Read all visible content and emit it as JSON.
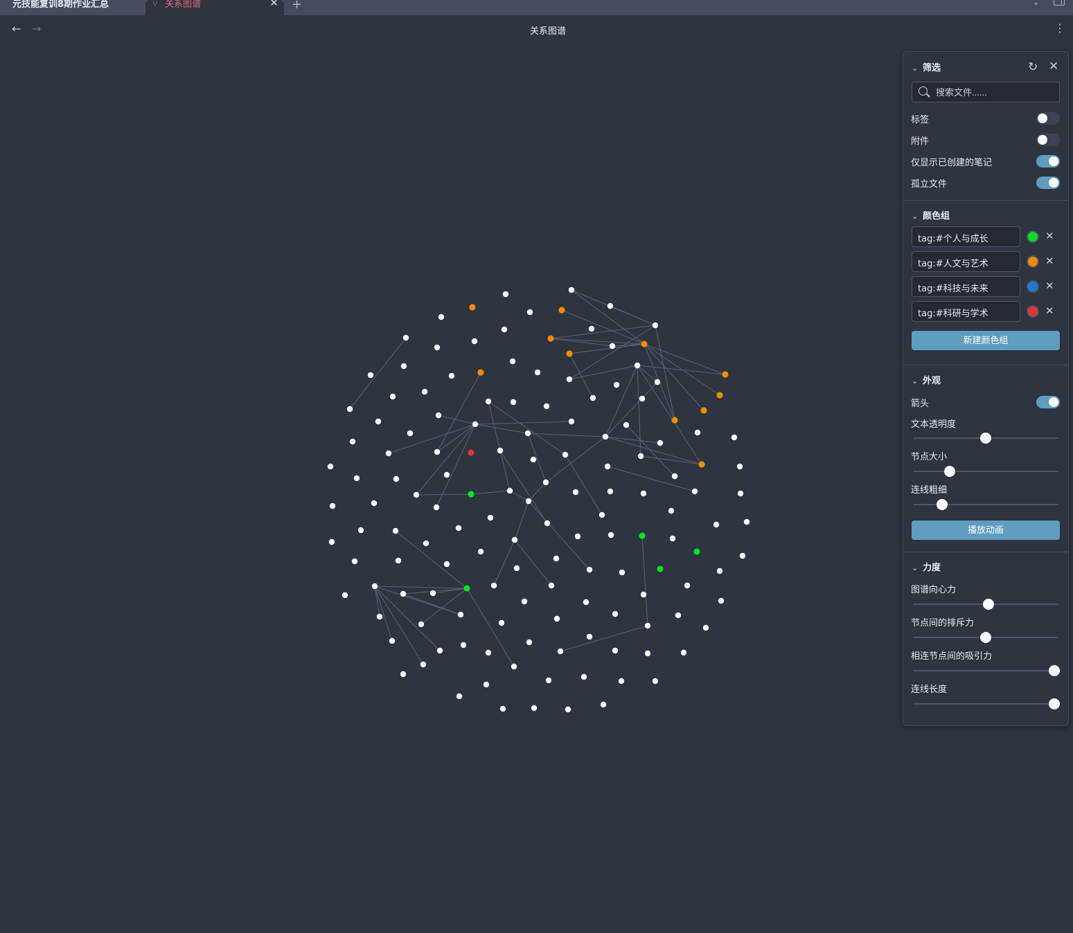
{
  "tabs": [
    {
      "label": "元技能复训8期作业汇总"
    },
    {
      "label": "关系图谱"
    }
  ],
  "header": {
    "title": "关系图谱"
  },
  "icons": {
    "back": "←",
    "forward": "→",
    "more": "⋮",
    "close": "✕",
    "add": "+",
    "chevron_down": "⌄",
    "graph": "⑂",
    "reset": "↻"
  },
  "colors": {
    "background": "#2e3440",
    "accent": "#5e9dbf",
    "node_default": "#ffffff",
    "edge": "#5a6274"
  },
  "panel": {
    "filter": {
      "title": "筛选",
      "search_placeholder": "搜索文件......",
      "toggles": [
        {
          "label": "标签",
          "on": false
        },
        {
          "label": "附件",
          "on": false
        },
        {
          "label": "仅显示已创建的笔记",
          "on": true
        },
        {
          "label": "孤立文件",
          "on": true
        }
      ]
    },
    "groups": {
      "title": "颜色组",
      "items": [
        {
          "query": "tag:#个人与成长",
          "color": "#00e31f"
        },
        {
          "query": "tag:#人文与艺术",
          "color": "#f28c00"
        },
        {
          "query": "tag:#科技与未来",
          "color": "#1f78d1"
        },
        {
          "query": "tag:#科研与学术",
          "color": "#e03535"
        }
      ],
      "new_button": "新建颜色组"
    },
    "display": {
      "title": "外观",
      "arrow_label": "箭头",
      "arrow_on": true,
      "sliders": [
        {
          "label": "文本透明度",
          "value": 0.5
        },
        {
          "label": "节点大小",
          "value": 0.25
        },
        {
          "label": "连线粗细",
          "value": 0.2
        }
      ],
      "animate_button": "播放动画"
    },
    "forces": {
      "title": "力度",
      "sliders": [
        {
          "label": "图谱向心力",
          "value": 0.52
        },
        {
          "label": "节点间的排斥力",
          "value": 0.5
        },
        {
          "label": "相连节点间的吸引力",
          "value": 0.97
        },
        {
          "label": "连线长度",
          "value": 0.97
        }
      ]
    }
  },
  "graph": {
    "nodes": [
      [
        825,
        419,
        "w"
      ],
      [
        730,
        425,
        "w"
      ],
      [
        682,
        444,
        "o"
      ],
      [
        881,
        442,
        "w"
      ],
      [
        811,
        448,
        "o"
      ],
      [
        765,
        451,
        "w"
      ],
      [
        637,
        458,
        "w"
      ],
      [
        946,
        470,
        "w"
      ],
      [
        854,
        475,
        "w"
      ],
      [
        728,
        476,
        "w"
      ],
      [
        586,
        488,
        "w"
      ],
      [
        795,
        489,
        "o"
      ],
      [
        685,
        493,
        "w"
      ],
      [
        930,
        497,
        "o"
      ],
      [
        884,
        500,
        "w"
      ],
      [
        631,
        502,
        "w"
      ],
      [
        822,
        511,
        "o"
      ],
      [
        740,
        522,
        "w"
      ],
      [
        920,
        528,
        "w"
      ],
      [
        583,
        529,
        "w"
      ],
      [
        694,
        538,
        "o"
      ],
      [
        776,
        538,
        "w"
      ],
      [
        1047,
        541,
        "o"
      ],
      [
        535,
        542,
        "w"
      ],
      [
        652,
        543,
        "w"
      ],
      [
        822,
        548,
        "w"
      ],
      [
        949,
        552,
        "w"
      ],
      [
        890,
        556,
        "w"
      ],
      [
        613,
        566,
        "w"
      ],
      [
        1039,
        571,
        "o"
      ],
      [
        567,
        573,
        "w"
      ],
      [
        856,
        575,
        "w"
      ],
      [
        927,
        576,
        "w"
      ],
      [
        705,
        580,
        "w"
      ],
      [
        741,
        581,
        "w"
      ],
      [
        789,
        587,
        "w"
      ],
      [
        505,
        591,
        "w"
      ],
      [
        1016,
        593,
        "o"
      ],
      [
        633,
        600,
        "w"
      ],
      [
        546,
        609,
        "w"
      ],
      [
        974,
        607,
        "o"
      ],
      [
        825,
        609,
        "w"
      ],
      [
        686,
        613,
        "w"
      ],
      [
        904,
        614,
        "w"
      ],
      [
        1007,
        625,
        "w"
      ],
      [
        762,
        626,
        "w"
      ],
      [
        592,
        626,
        "w"
      ],
      [
        874,
        631,
        "w"
      ],
      [
        1060,
        632,
        "w"
      ],
      [
        509,
        638,
        "w"
      ],
      [
        953,
        640,
        "w"
      ],
      [
        722,
        651,
        "w"
      ],
      [
        631,
        653,
        "w"
      ],
      [
        680,
        654,
        "r"
      ],
      [
        561,
        655,
        "w"
      ],
      [
        816,
        657,
        "w"
      ],
      [
        925,
        659,
        "w"
      ],
      [
        770,
        664,
        "w"
      ],
      [
        1013,
        671,
        "o"
      ],
      [
        477,
        674,
        "w"
      ],
      [
        877,
        674,
        "w"
      ],
      [
        1068,
        674,
        "w"
      ],
      [
        645,
        686,
        "w"
      ],
      [
        974,
        688,
        "w"
      ],
      [
        515,
        691,
        "w"
      ],
      [
        572,
        692,
        "w"
      ],
      [
        788,
        697,
        "w"
      ],
      [
        1003,
        710,
        "w"
      ],
      [
        736,
        709,
        "w"
      ],
      [
        881,
        710,
        "w"
      ],
      [
        831,
        711,
        "w"
      ],
      [
        929,
        713,
        "w"
      ],
      [
        601,
        715,
        "w"
      ],
      [
        680,
        714,
        "g"
      ],
      [
        1069,
        713,
        "w"
      ],
      [
        763,
        724,
        "w"
      ],
      [
        540,
        727,
        "w"
      ],
      [
        480,
        731,
        "w"
      ],
      [
        630,
        733,
        "w"
      ],
      [
        969,
        738,
        "w"
      ],
      [
        869,
        744,
        "w"
      ],
      [
        708,
        748,
        "w"
      ],
      [
        1078,
        754,
        "w"
      ],
      [
        790,
        756,
        "w"
      ],
      [
        1034,
        758,
        "w"
      ],
      [
        662,
        763,
        "w"
      ],
      [
        521,
        766,
        "w"
      ],
      [
        571,
        767,
        "w"
      ],
      [
        927,
        774,
        "g"
      ],
      [
        882,
        773,
        "w"
      ],
      [
        834,
        775,
        "w"
      ],
      [
        971,
        778,
        "w"
      ],
      [
        743,
        780,
        "w"
      ],
      [
        479,
        783,
        "w"
      ],
      [
        615,
        785,
        "w"
      ],
      [
        694,
        797,
        "w"
      ],
      [
        1006,
        797,
        "g"
      ],
      [
        1072,
        803,
        "w"
      ],
      [
        803,
        807,
        "w"
      ],
      [
        512,
        811,
        "w"
      ],
      [
        575,
        810,
        "w"
      ],
      [
        645,
        815,
        "w"
      ],
      [
        746,
        821,
        "w"
      ],
      [
        953,
        822,
        "g"
      ],
      [
        851,
        823,
        "w"
      ],
      [
        898,
        827,
        "w"
      ],
      [
        1039,
        825,
        "w"
      ],
      [
        992,
        846,
        "w"
      ],
      [
        541,
        847,
        "w"
      ],
      [
        713,
        846,
        "w"
      ],
      [
        796,
        846,
        "w"
      ],
      [
        674,
        850,
        "g"
      ],
      [
        625,
        857,
        "w"
      ],
      [
        582,
        858,
        "w"
      ],
      [
        498,
        860,
        "w"
      ],
      [
        929,
        859,
        "w"
      ],
      [
        1041,
        868,
        "w"
      ],
      [
        757,
        869,
        "w"
      ],
      [
        846,
        870,
        "w"
      ],
      [
        665,
        888,
        "w"
      ],
      [
        979,
        889,
        "w"
      ],
      [
        888,
        887,
        "w"
      ],
      [
        548,
        891,
        "w"
      ],
      [
        804,
        894,
        "w"
      ],
      [
        724,
        900,
        "w"
      ],
      [
        608,
        902,
        "w"
      ],
      [
        935,
        904,
        "w"
      ],
      [
        1019,
        907,
        "w"
      ],
      [
        851,
        920,
        "w"
      ],
      [
        566,
        926,
        "w"
      ],
      [
        764,
        928,
        "w"
      ],
      [
        669,
        932,
        "w"
      ],
      [
        635,
        940,
        "w"
      ],
      [
        888,
        940,
        "w"
      ],
      [
        705,
        943,
        "w"
      ],
      [
        809,
        941,
        "w"
      ],
      [
        935,
        944,
        "w"
      ],
      [
        987,
        943,
        "w"
      ],
      [
        611,
        960,
        "w"
      ],
      [
        742,
        963,
        "w"
      ],
      [
        582,
        974,
        "w"
      ],
      [
        843,
        978,
        "w"
      ],
      [
        792,
        983,
        "w"
      ],
      [
        897,
        984,
        "w"
      ],
      [
        946,
        984,
        "w"
      ],
      [
        702,
        989,
        "w"
      ],
      [
        663,
        1006,
        "w"
      ],
      [
        871,
        1018,
        "w"
      ],
      [
        726,
        1024,
        "w"
      ],
      [
        771,
        1023,
        "w"
      ],
      [
        820,
        1025,
        "w"
      ]
    ],
    "edges": [
      [
        825,
        419,
        946,
        470
      ],
      [
        825,
        419,
        930,
        497
      ],
      [
        811,
        448,
        930,
        497
      ],
      [
        881,
        442,
        946,
        470
      ],
      [
        795,
        489,
        946,
        470
      ],
      [
        795,
        489,
        930,
        497
      ],
      [
        795,
        489,
        884,
        500
      ],
      [
        822,
        511,
        930,
        497
      ],
      [
        822,
        511,
        856,
        575
      ],
      [
        884,
        500,
        930,
        497
      ],
      [
        822,
        548,
        946,
        470
      ],
      [
        822,
        548,
        920,
        528
      ],
      [
        930,
        497,
        1047,
        541
      ],
      [
        930,
        497,
        1016,
        593
      ],
      [
        930,
        497,
        974,
        607
      ],
      [
        930,
        497,
        1039,
        571
      ],
      [
        946,
        470,
        974,
        607
      ],
      [
        920,
        528,
        1047,
        541
      ],
      [
        920,
        528,
        874,
        631
      ],
      [
        920,
        528,
        925,
        659
      ],
      [
        920,
        528,
        949,
        552
      ],
      [
        949,
        552,
        874,
        631
      ],
      [
        920,
        528,
        1013,
        671
      ],
      [
        925,
        659,
        1013,
        671
      ],
      [
        874,
        631,
        1013,
        671
      ],
      [
        874,
        631,
        953,
        640
      ],
      [
        904,
        614,
        974,
        688
      ],
      [
        877,
        674,
        1003,
        710
      ],
      [
        874,
        631,
        788,
        697
      ],
      [
        788,
        697,
        763,
        724
      ],
      [
        686,
        613,
        825,
        609
      ],
      [
        686,
        613,
        633,
        600
      ],
      [
        686,
        613,
        762,
        626
      ],
      [
        686,
        613,
        631,
        653
      ],
      [
        686,
        613,
        601,
        715
      ],
      [
        686,
        613,
        630,
        733
      ],
      [
        686,
        613,
        561,
        655
      ],
      [
        694,
        538,
        631,
        653
      ],
      [
        705,
        580,
        736,
        709
      ],
      [
        705,
        580,
        816,
        657
      ],
      [
        722,
        651,
        790,
        756
      ],
      [
        762,
        626,
        788,
        697
      ],
      [
        762,
        626,
        874,
        631
      ],
      [
        680,
        714,
        736,
        709
      ],
      [
        601,
        715,
        680,
        714
      ],
      [
        736,
        709,
        763,
        724
      ],
      [
        763,
        724,
        743,
        780
      ],
      [
        743,
        780,
        713,
        846
      ],
      [
        743,
        780,
        796,
        846
      ],
      [
        763,
        724,
        851,
        823
      ],
      [
        816,
        657,
        869,
        744
      ],
      [
        586,
        488,
        505,
        591
      ],
      [
        674,
        850,
        571,
        767
      ],
      [
        674,
        850,
        541,
        847
      ],
      [
        674,
        850,
        625,
        857
      ],
      [
        674,
        850,
        582,
        858
      ],
      [
        674,
        850,
        608,
        902
      ],
      [
        674,
        850,
        742,
        963
      ],
      [
        541,
        847,
        665,
        888
      ],
      [
        541,
        847,
        548,
        891
      ],
      [
        541,
        847,
        566,
        926
      ],
      [
        541,
        847,
        611,
        960
      ],
      [
        541,
        847,
        635,
        940
      ],
      [
        582,
        858,
        665,
        888
      ],
      [
        927,
        774,
        935,
        904
      ],
      [
        809,
        941,
        935,
        904
      ]
    ]
  }
}
